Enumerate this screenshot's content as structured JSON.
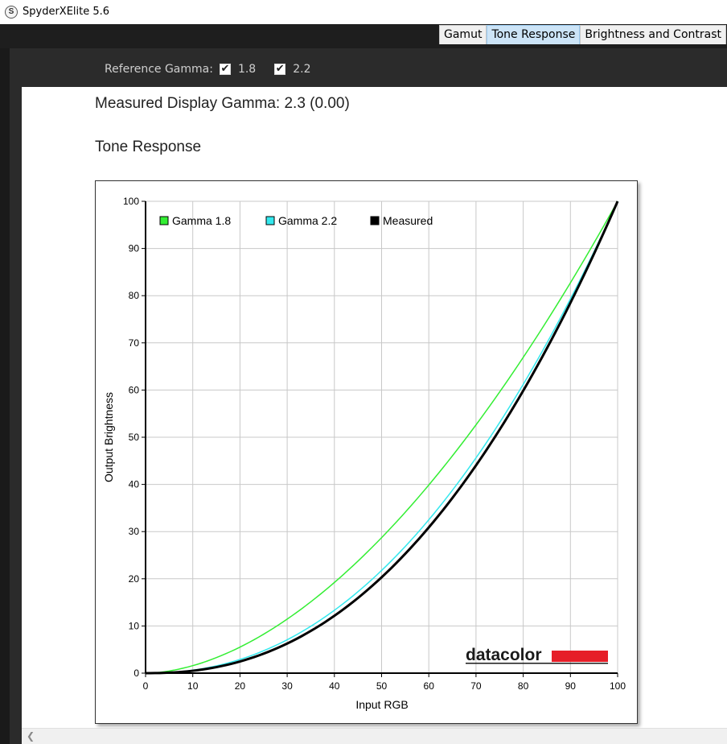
{
  "app": {
    "title": "SpyderXElite 5.6",
    "icon_letter": "S"
  },
  "tabs": [
    {
      "label": "Gamut",
      "active": false
    },
    {
      "label": "Tone Response",
      "active": true
    },
    {
      "label": "Brightness and Contrast",
      "active": false
    }
  ],
  "reference_gamma": {
    "label": "Reference Gamma:",
    "options": [
      {
        "label": "1.8",
        "checked": true
      },
      {
        "label": "2.2",
        "checked": true
      }
    ]
  },
  "measured_display_gamma": "Measured Display Gamma: 2.3 (0.00)",
  "section_title": "Tone Response",
  "chart_data": {
    "type": "line",
    "xlabel": "Input RGB",
    "ylabel": "Output Brightness",
    "xlim": [
      0,
      100
    ],
    "ylim": [
      0,
      100
    ],
    "xticks": [
      0,
      10,
      20,
      30,
      40,
      50,
      60,
      70,
      80,
      90,
      100
    ],
    "yticks": [
      0,
      10,
      20,
      30,
      40,
      50,
      60,
      70,
      80,
      90,
      100
    ],
    "grid": true,
    "legend_position": "top-left",
    "series": [
      {
        "name": "Gamma 1.8",
        "color": "#33ee33",
        "gamma": 1.8,
        "x": [
          0,
          10,
          20,
          30,
          40,
          50,
          60,
          70,
          80,
          90,
          100
        ],
        "y": [
          0,
          1.6,
          5.5,
          11.5,
          19.2,
          28.7,
          39.9,
          52.6,
          66.9,
          82.7,
          100
        ]
      },
      {
        "name": "Gamma 2.2",
        "color": "#33e8ee",
        "gamma": 2.2,
        "x": [
          0,
          10,
          20,
          30,
          40,
          50,
          60,
          70,
          80,
          90,
          100
        ],
        "y": [
          0,
          0.6,
          2.9,
          7.1,
          13.3,
          21.8,
          32.5,
          45.6,
          61.2,
          79.3,
          100
        ]
      },
      {
        "name": "Measured",
        "color": "#000000",
        "gamma": 2.3,
        "x": [
          0,
          10,
          20,
          30,
          40,
          50,
          60,
          70,
          80,
          90,
          100
        ],
        "y": [
          0,
          0.5,
          2.5,
          6.3,
          12.1,
          20.3,
          30.9,
          44.0,
          59.8,
          78.5,
          100
        ]
      }
    ]
  },
  "watermark": "datacolor"
}
